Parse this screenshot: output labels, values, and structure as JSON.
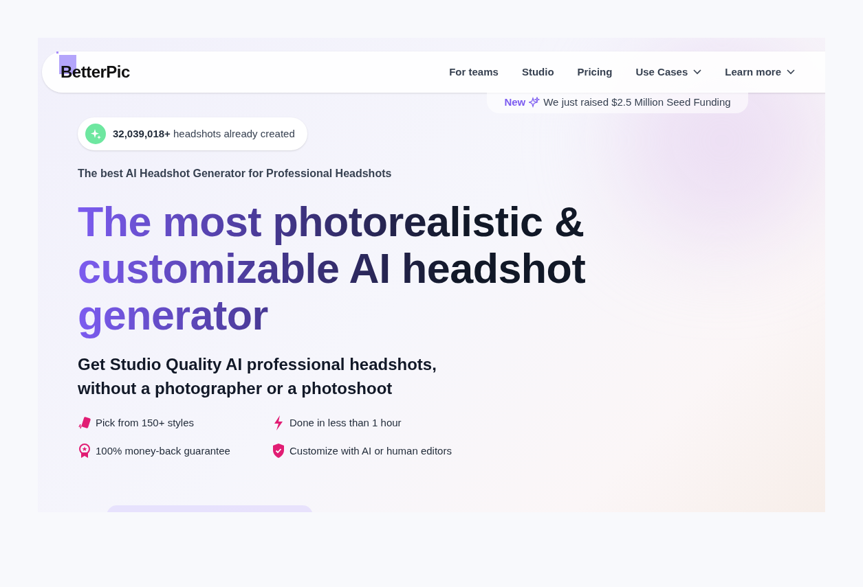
{
  "logo": "BetterPic",
  "nav": [
    {
      "label": "For teams",
      "has_menu": false
    },
    {
      "label": "Studio",
      "has_menu": false
    },
    {
      "label": "Pricing",
      "has_menu": false
    },
    {
      "label": "Use Cases",
      "has_menu": true
    },
    {
      "label": "Learn more",
      "has_menu": true
    }
  ],
  "announcement": {
    "badge": "New",
    "text": "We just raised $2.5 Million Seed Funding"
  },
  "counter": {
    "count": "32,039,018+",
    "text": "headshots already created"
  },
  "eyebrow": "The best AI Headshot Generator for Professional Headshots",
  "headline": [
    "The most photorealistic &",
    "customizable AI headshot",
    "generator"
  ],
  "subheadline": [
    "Get Studio Quality AI professional headshots,",
    "without a photographer or a photoshoot"
  ],
  "features": [
    {
      "kind": "cards",
      "text": "Pick from 150+ styles"
    },
    {
      "kind": "bolt",
      "text": "Done in less than 1 hour"
    },
    {
      "kind": "medal",
      "text": "100% money-back guarantee"
    },
    {
      "kind": "shield",
      "text": "Customize with AI or human editors"
    }
  ]
}
